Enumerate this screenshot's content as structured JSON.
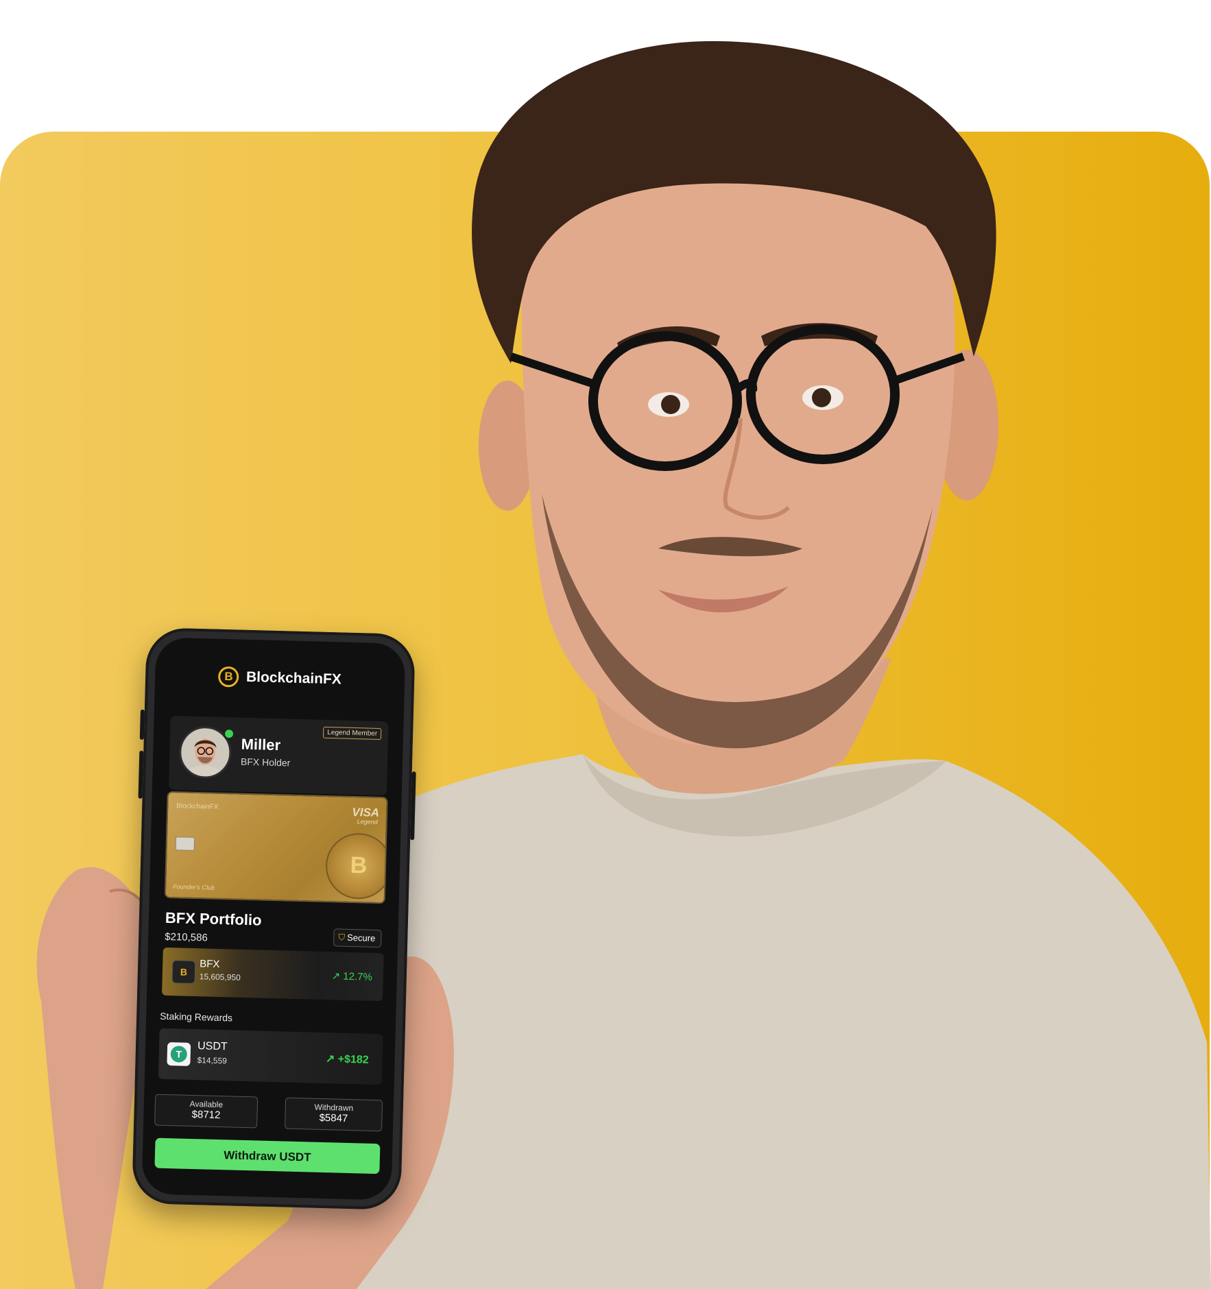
{
  "app": {
    "brand": "BlockchainFX",
    "logo_glyph": "B"
  },
  "profile": {
    "name": "Miller",
    "role": "BFX Holder",
    "badge": "Legend Member",
    "online": true
  },
  "card": {
    "brand": "BlockchainFX",
    "network": "VISA",
    "tier": "Legend",
    "club": "Founder's Club"
  },
  "portfolio": {
    "title": "BFX Portfolio",
    "total": "$210,586",
    "secure_label": "Secure"
  },
  "holdings": {
    "bfx": {
      "symbol": "BFX",
      "amount": "15,605,950",
      "change": "↗ 12.7%"
    },
    "staking_label": "Staking Rewards",
    "usdt": {
      "symbol": "USDT",
      "amount": "$14,559",
      "change": "↗ +$182"
    }
  },
  "stats": {
    "available": {
      "label": "Available",
      "value": "$8712"
    },
    "withdrawn": {
      "label": "Withdrawn",
      "value": "$5847"
    }
  },
  "actions": {
    "withdraw_label": "Withdraw USDT"
  },
  "colors": {
    "accent_gold": "#e8b320",
    "positive_green": "#39d353",
    "button_green": "#5ee06f",
    "background_yellow": "#efc240"
  }
}
